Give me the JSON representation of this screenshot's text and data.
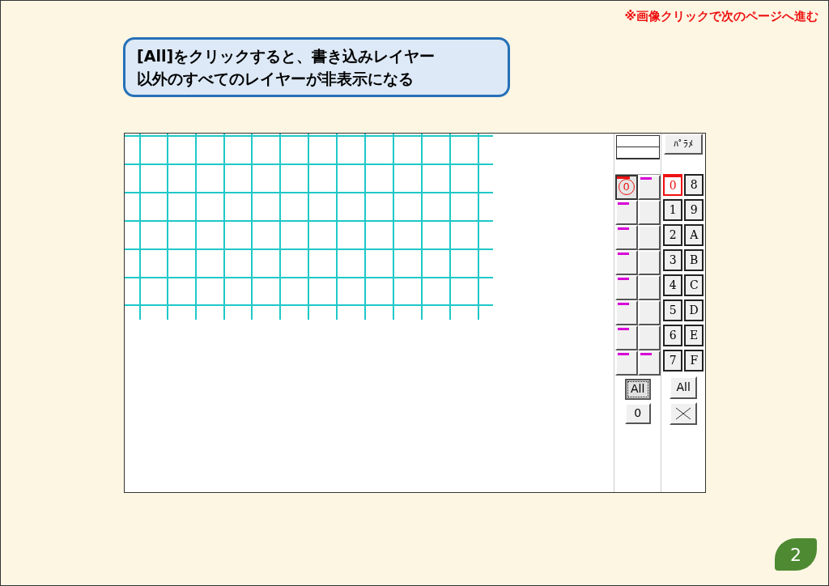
{
  "note": "※画像クリックで次のページへ進む",
  "callout": {
    "lines": [
      "[All]をクリックすると、書き込みレイヤー",
      "以外のすべてのレイヤーが非表示になる"
    ]
  },
  "panel": {
    "param_button": "ﾊﾟﾗﾒ",
    "layers": [
      [
        {
          "label": "0",
          "writing": true,
          "marked": false
        },
        {
          "writing": false,
          "marked": true
        }
      ],
      [
        {
          "writing": false,
          "marked": true
        },
        {
          "writing": false,
          "marked": false
        }
      ],
      [
        {
          "writing": false,
          "marked": true
        },
        {
          "writing": false,
          "marked": false
        }
      ],
      [
        {
          "writing": false,
          "marked": true
        },
        {
          "writing": false,
          "marked": false
        }
      ],
      [
        {
          "writing": false,
          "marked": true
        },
        {
          "writing": false,
          "marked": false
        }
      ],
      [
        {
          "writing": false,
          "marked": true
        },
        {
          "writing": false,
          "marked": false
        }
      ],
      [
        {
          "writing": false,
          "marked": true
        },
        {
          "writing": false,
          "marked": false
        }
      ],
      [
        {
          "writing": false,
          "marked": true
        },
        {
          "writing": false,
          "marked": true
        }
      ]
    ],
    "layer_buttons": [
      {
        "label": "All",
        "pressed": true
      },
      {
        "label": "0",
        "pressed": false
      }
    ],
    "groups": [
      [
        {
          "label": "0",
          "selected": true
        },
        {
          "label": "8",
          "selected": false
        }
      ],
      [
        {
          "label": "1",
          "selected": false
        },
        {
          "label": "9",
          "selected": false
        }
      ],
      [
        {
          "label": "2",
          "selected": false
        },
        {
          "label": "A",
          "selected": false
        }
      ],
      [
        {
          "label": "3",
          "selected": false
        },
        {
          "label": "B",
          "selected": false
        }
      ],
      [
        {
          "label": "4",
          "selected": false
        },
        {
          "label": "C",
          "selected": false
        }
      ],
      [
        {
          "label": "5",
          "selected": false
        },
        {
          "label": "D",
          "selected": false
        }
      ],
      [
        {
          "label": "6",
          "selected": false
        },
        {
          "label": "E",
          "selected": false
        }
      ],
      [
        {
          "label": "7",
          "selected": false
        },
        {
          "label": "F",
          "selected": false
        }
      ]
    ],
    "group_all": "All"
  },
  "page_number": "2"
}
